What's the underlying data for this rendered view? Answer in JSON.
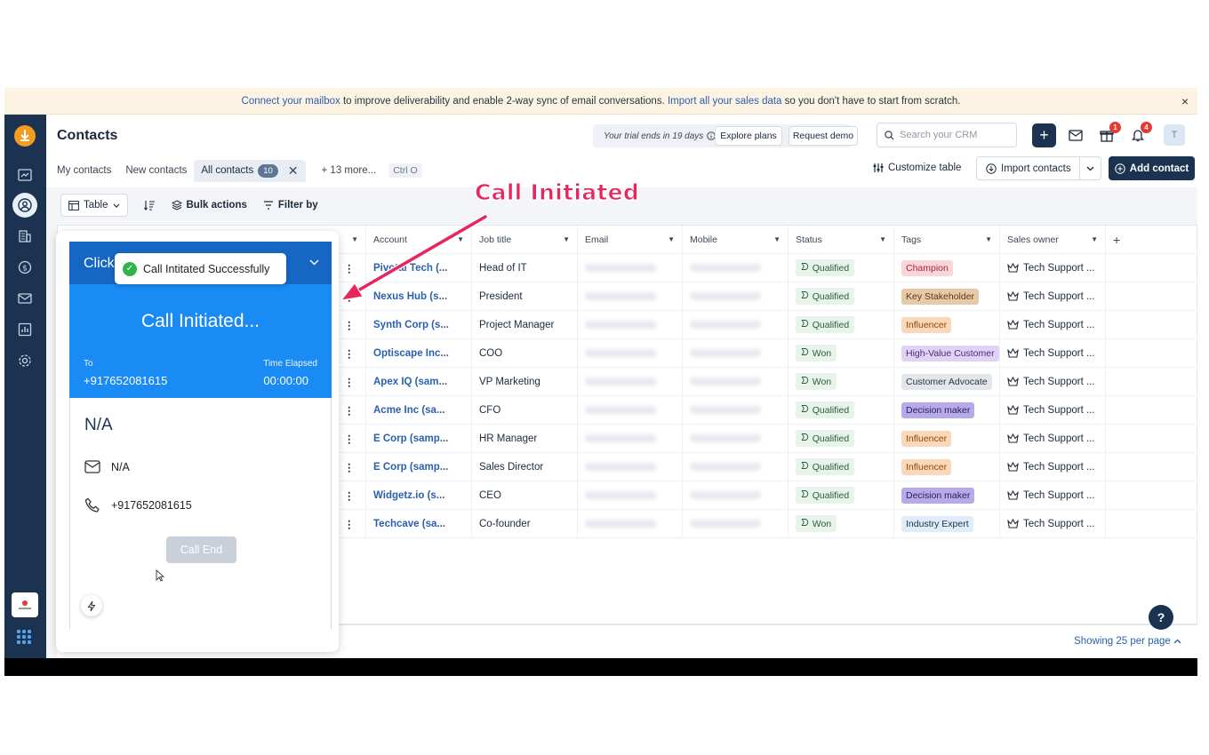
{
  "banner": {
    "link1": "Connect your mailbox",
    "text1": " to improve deliverability and enable 2-way sync of email conversations. ",
    "link2": "Import all your sales data",
    "text2": " so you don't have to start from scratch.",
    "close": "×"
  },
  "page": {
    "title": "Contacts"
  },
  "header": {
    "trial": "Your trial ends in 19 days",
    "explore": "Explore plans",
    "demo": "Request demo",
    "search_placeholder": "Search your CRM",
    "gift_badge": "1",
    "bell_badge": "4",
    "avatar": "T"
  },
  "tabs": {
    "my": "My contacts",
    "new": "New contacts",
    "all": "All contacts",
    "all_count": "10",
    "more": "+ 13 more...",
    "shortcut": "Ctrl O"
  },
  "actions": {
    "customize": "Customize table",
    "import": "Import contacts",
    "add": "Add contact"
  },
  "toolbar": {
    "view": "Table",
    "bulk": "Bulk actions",
    "filter": "Filter by"
  },
  "table": {
    "headers": {
      "account": "Account",
      "job": "Job title",
      "email": "Email",
      "mobile": "Mobile",
      "status": "Status",
      "tags": "Tags",
      "owner": "Sales owner"
    },
    "rows": [
      {
        "account": "Pivotal Tech (...",
        "job": "Head of IT",
        "status": "Qualified",
        "tag": "Champion",
        "tag_bg": "#f9d6d9",
        "tag_fg": "#b0223a",
        "owner": "Tech Support ..."
      },
      {
        "account": "Nexus Hub (s...",
        "job": "President",
        "status": "Qualified",
        "tag": "Key Stakeholder",
        "tag_bg": "#e7c9a8",
        "tag_fg": "#5a3a1a",
        "owner": "Tech Support ..."
      },
      {
        "account": "Synth Corp (s...",
        "job": "Project Manager",
        "status": "Qualified",
        "tag": "Influencer",
        "tag_bg": "#fbd9b8",
        "tag_fg": "#8a4a10",
        "owner": "Tech Support ..."
      },
      {
        "account": "Optiscape Inc...",
        "job": "COO",
        "status": "Won",
        "tag": "High-Value Customer",
        "tag_bg": "#e1d2f5",
        "tag_fg": "#4a2a7a",
        "owner": "Tech Support ..."
      },
      {
        "account": "Apex IQ (sam...",
        "job": "VP Marketing",
        "status": "Won",
        "tag": "Customer Advocate",
        "tag_bg": "#e3e7ec",
        "tag_fg": "#2a3644",
        "owner": "Tech Support ..."
      },
      {
        "account": "Acme Inc (sa...",
        "job": "CFO",
        "status": "Qualified",
        "tag": "Decision maker",
        "tag_bg": "#b7a9ea",
        "tag_fg": "#2a1f5a",
        "owner": "Tech Support ..."
      },
      {
        "account": "E Corp (samp...",
        "job": "HR Manager",
        "status": "Qualified",
        "tag": "Influencer",
        "tag_bg": "#fbd9b8",
        "tag_fg": "#8a4a10",
        "owner": "Tech Support ..."
      },
      {
        "account": "E Corp (samp...",
        "job": "Sales Director",
        "status": "Qualified",
        "tag": "Influencer",
        "tag_bg": "#fbd9b8",
        "tag_fg": "#8a4a10",
        "owner": "Tech Support ..."
      },
      {
        "account": "Widgetz.io (s...",
        "job": "CEO",
        "status": "Qualified",
        "tag": "Decision maker",
        "tag_bg": "#b7a9ea",
        "tag_fg": "#2a1f5a",
        "owner": "Tech Support ..."
      },
      {
        "account": "Techcave (sa...",
        "job": "Co-founder",
        "status": "Won",
        "tag": "Industry Expert",
        "tag_bg": "#e0ecf9",
        "tag_fg": "#22354a",
        "owner": "Tech Support ..."
      }
    ]
  },
  "footer": {
    "showing": "Showing 25 per page"
  },
  "help": "?",
  "widget": {
    "head_text": "Click",
    "toast": "Call Intitated Successfully",
    "status": "Call Initiated...",
    "to_label": "To",
    "to_number": "+917652081615",
    "elapsed_label": "Time Elapsed",
    "elapsed": "00:00:00",
    "name": "N/A",
    "email": "N/A",
    "phone": "+917652081615",
    "end": "Call End"
  },
  "annotation": "Call Initiated",
  "colors": {
    "brand_dark": "#1b3350",
    "call_blue": "#1a8bf5",
    "annotation": "#e8265e"
  }
}
